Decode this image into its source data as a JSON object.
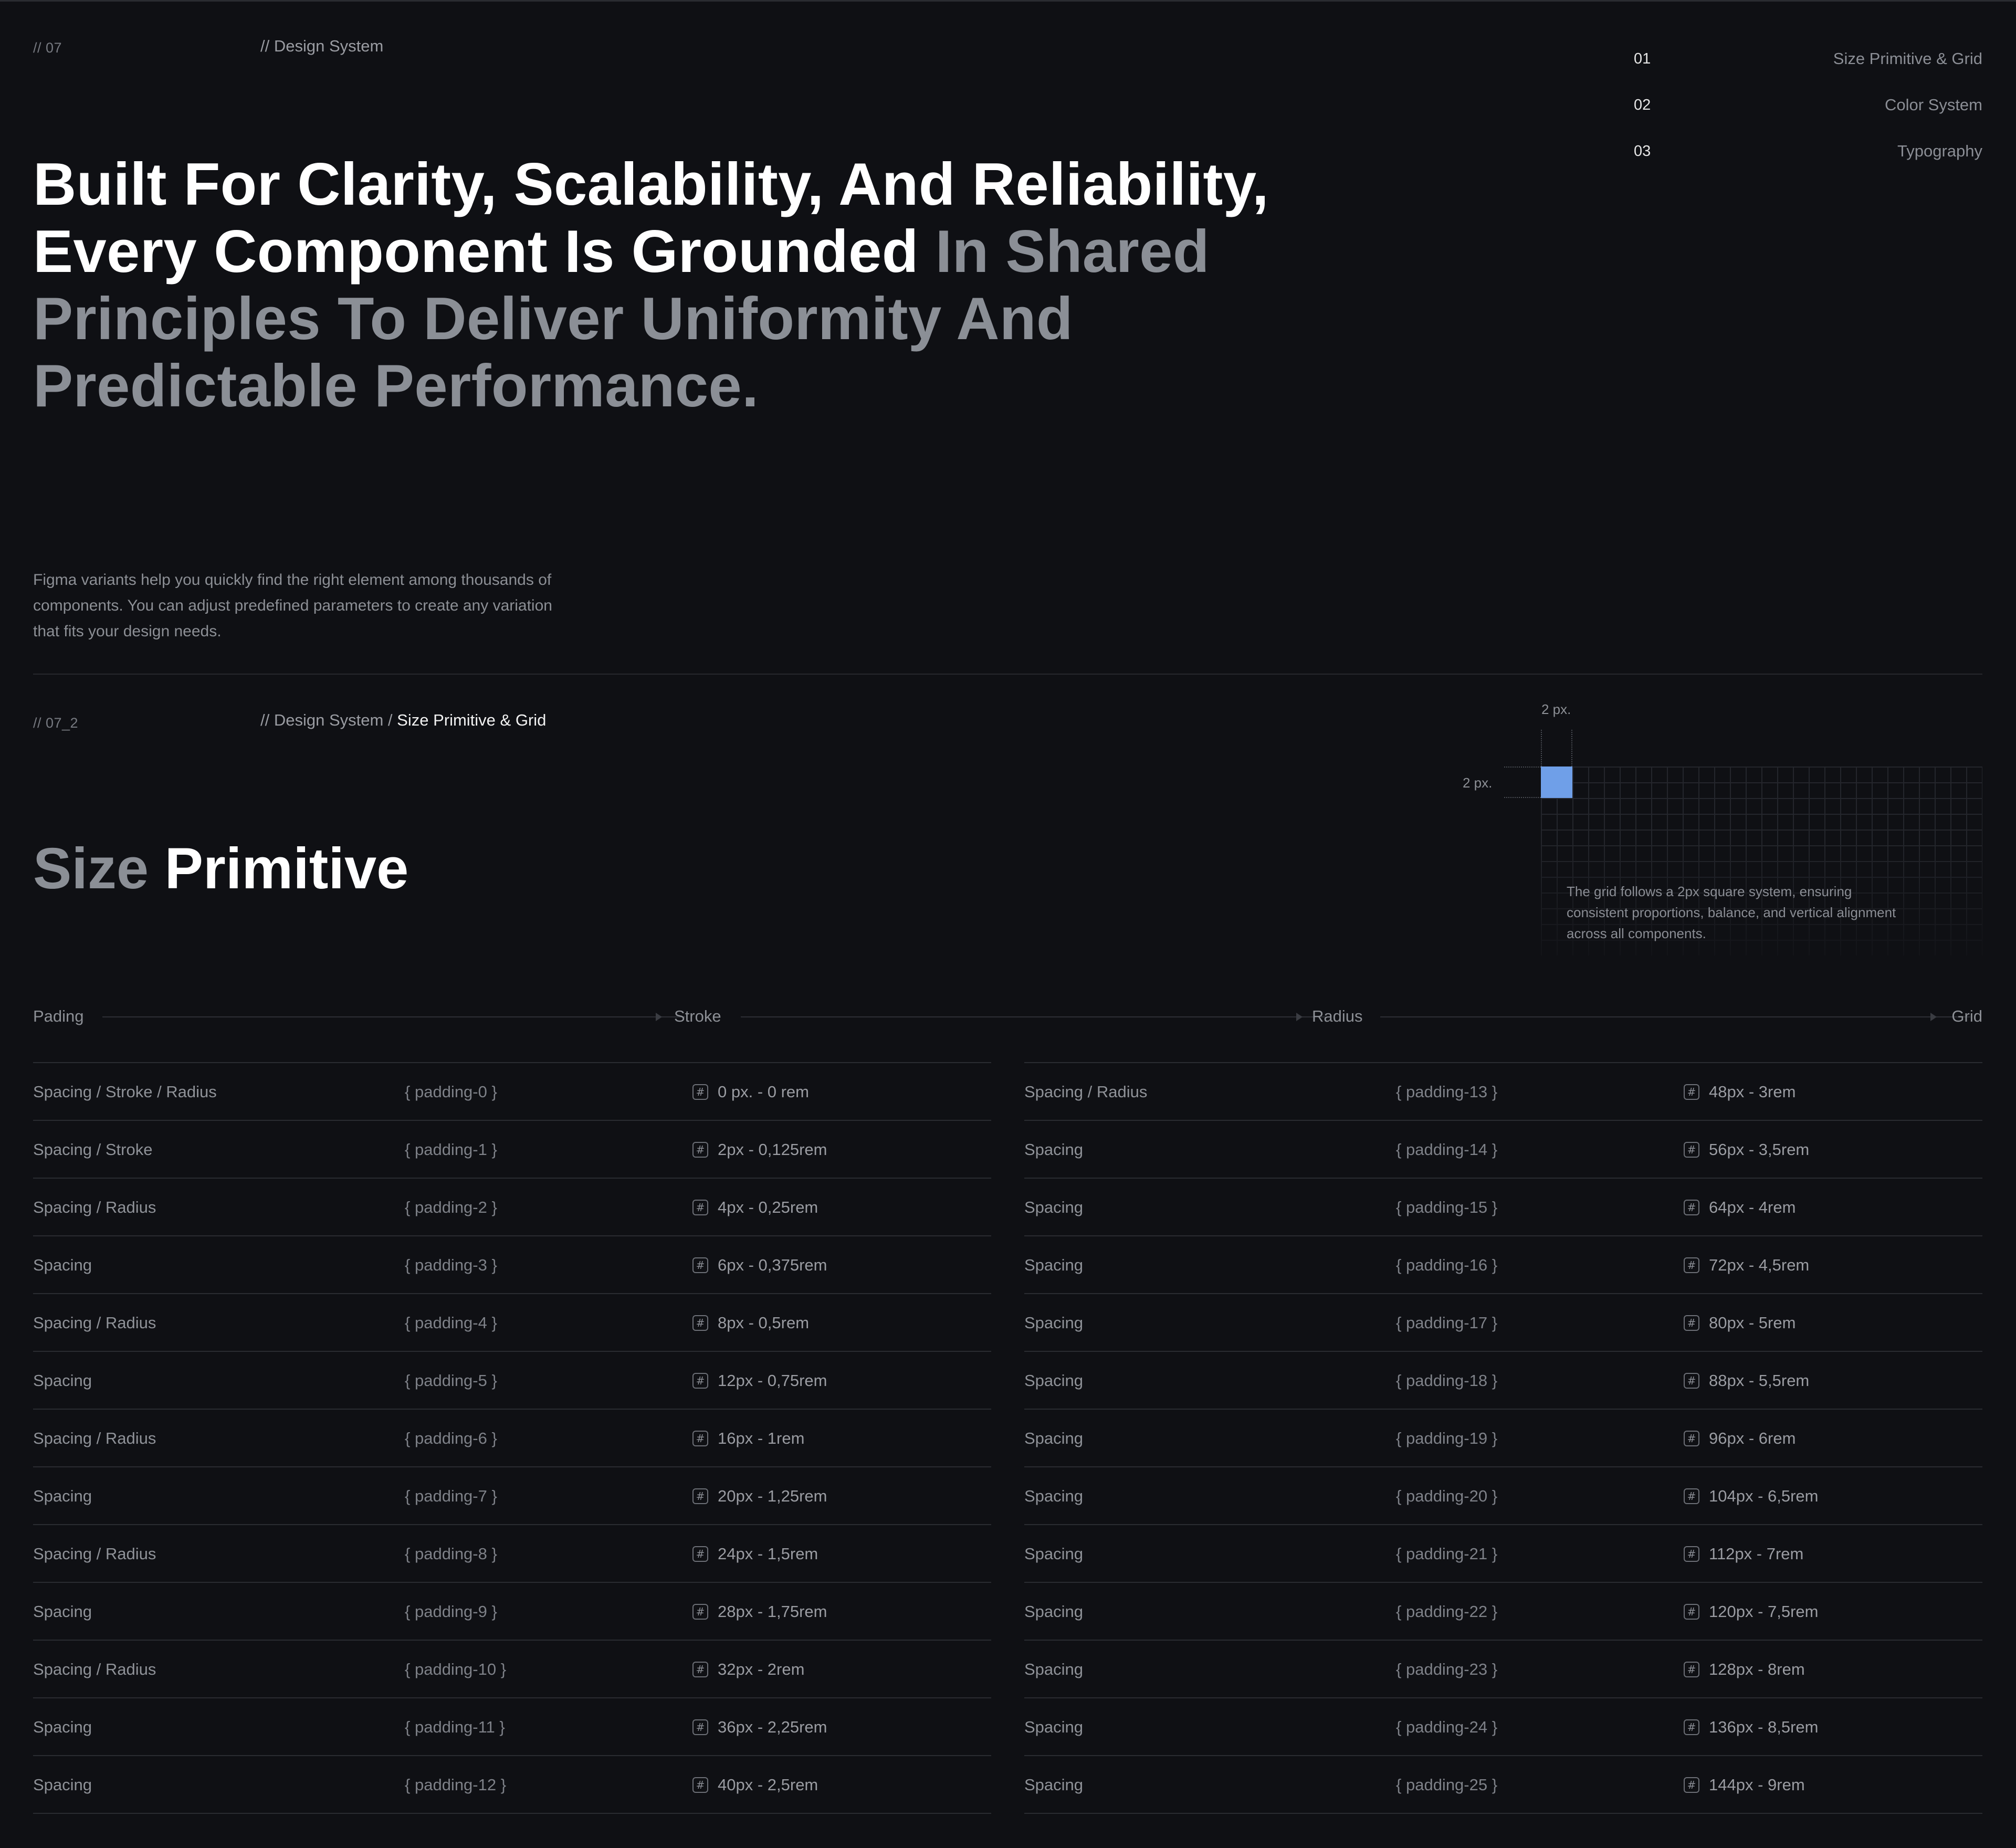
{
  "header": {
    "section_number": "// 07",
    "breadcrumb": "// Design System"
  },
  "toc": [
    {
      "num": "01",
      "label": "Size Primitive & Grid"
    },
    {
      "num": "02",
      "label": "Color System"
    },
    {
      "num": "03",
      "label": "Typography"
    }
  ],
  "headline": {
    "bright": "Built For Clarity, Scalability, And Reliability, Every Component Is Grounded ",
    "dim": "In Shared Principles To Deliver Uniformity And Predictable Performance."
  },
  "intro": "Figma variants help you quickly find the right element among thousands of components. You can adjust predefined parameters to create any variation that fits your design needs.",
  "section2": {
    "section_number": "// 07_2",
    "breadcrumb_prefix": "// Design System /",
    "breadcrumb_current": "Size Primitive & Grid",
    "title_dim": "Size",
    "title_bright": "Primitive"
  },
  "grid_demo": {
    "width_label": "2 px.",
    "height_label": "2 px.",
    "note": "The grid follows a 2px square system, ensuring consistent proportions, balance, and vertical alignment across all components.",
    "cell_color": "#6f9fe8"
  },
  "axis": {
    "labels": [
      "Pading",
      "Stroke",
      "Radius",
      "Grid"
    ]
  },
  "table_left": [
    {
      "name": "Spacing / Stroke / Radius",
      "token": "{ padding-0 }",
      "value": "0 px. - 0 rem"
    },
    {
      "name": "Spacing / Stroke",
      "token": "{ padding-1 }",
      "value": "2px - 0,125rem"
    },
    {
      "name": "Spacing / Radius",
      "token": "{ padding-2 }",
      "value": "4px - 0,25rem"
    },
    {
      "name": "Spacing",
      "token": "{ padding-3 }",
      "value": "6px - 0,375rem"
    },
    {
      "name": "Spacing / Radius",
      "token": "{ padding-4 }",
      "value": "8px - 0,5rem"
    },
    {
      "name": "Spacing",
      "token": "{ padding-5 }",
      "value": "12px - 0,75rem"
    },
    {
      "name": "Spacing / Radius",
      "token": "{ padding-6 }",
      "value": "16px - 1rem"
    },
    {
      "name": "Spacing",
      "token": "{ padding-7 }",
      "value": "20px - 1,25rem"
    },
    {
      "name": "Spacing / Radius",
      "token": "{ padding-8 }",
      "value": "24px - 1,5rem"
    },
    {
      "name": "Spacing",
      "token": "{ padding-9 }",
      "value": "28px - 1,75rem"
    },
    {
      "name": "Spacing / Radius",
      "token": "{ padding-10 }",
      "value": "32px - 2rem"
    },
    {
      "name": "Spacing",
      "token": "{ padding-11 }",
      "value": "36px - 2,25rem"
    },
    {
      "name": "Spacing",
      "token": "{ padding-12 }",
      "value": "40px - 2,5rem"
    }
  ],
  "table_right": [
    {
      "name": "Spacing / Radius",
      "token": "{ padding-13 }",
      "value": "48px - 3rem"
    },
    {
      "name": "Spacing",
      "token": "{ padding-14 }",
      "value": "56px - 3,5rem"
    },
    {
      "name": "Spacing",
      "token": "{ padding-15 }",
      "value": "64px - 4rem"
    },
    {
      "name": "Spacing",
      "token": "{ padding-16 }",
      "value": "72px - 4,5rem"
    },
    {
      "name": "Spacing",
      "token": "{ padding-17 }",
      "value": "80px - 5rem"
    },
    {
      "name": "Spacing",
      "token": "{ padding-18 }",
      "value": "88px - 5,5rem"
    },
    {
      "name": "Spacing",
      "token": "{ padding-19 }",
      "value": "96px - 6rem"
    },
    {
      "name": "Spacing",
      "token": "{ padding-20 }",
      "value": "104px - 6,5rem"
    },
    {
      "name": "Spacing",
      "token": "{ padding-21 }",
      "value": "112px - 7rem"
    },
    {
      "name": "Spacing",
      "token": "{ padding-22 }",
      "value": "120px - 7,5rem"
    },
    {
      "name": "Spacing",
      "token": "{ padding-23 }",
      "value": "128px - 8rem"
    },
    {
      "name": "Spacing",
      "token": "{ padding-24 }",
      "value": "136px - 8,5rem"
    },
    {
      "name": "Spacing",
      "token": "{ padding-25 }",
      "value": "144px - 9rem"
    }
  ],
  "icons": {
    "value_marker": "hash-icon"
  }
}
